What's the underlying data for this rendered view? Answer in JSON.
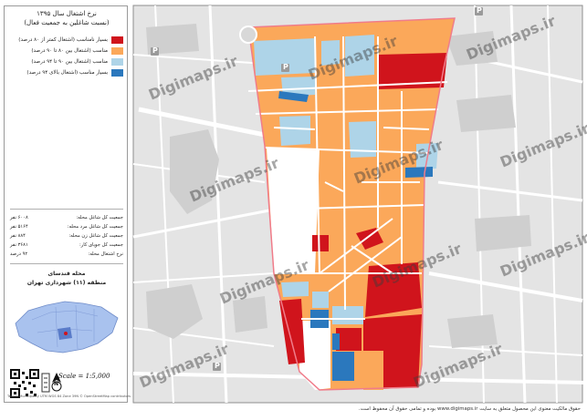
{
  "panel": {
    "title_line1": "نرخ اشتغال سال ۱۳۹۵",
    "title_line2": "(نسبت شاغلین به جمعیت فعال)",
    "legend": [
      {
        "label": "بسیار نامناسب (اشتغال کمتر از ۸۰ درصد)",
        "color": "#d0141c"
      },
      {
        "label": "مناسب (اشتغال بین ۸۰ تا ۹۰ درصد)",
        "color": "#fba85a"
      },
      {
        "label": "مناسب (اشتغال بین ۹۰ تا ۹۴ درصد)",
        "color": "#aed4e8"
      },
      {
        "label": "بسیار مناسب (اشتغال بالای ۹۴ درصد)",
        "color": "#2b78bd"
      }
    ],
    "stats": [
      {
        "label": "جمعیت کل شاغل محله:",
        "value": "۶۰۰۸ نفر"
      },
      {
        "label": "جمعیت کل شاغل مرد محله:",
        "value": "۵۱۶۴ نفر"
      },
      {
        "label": "جمعیت کل شاغل زن محله:",
        "value": "۸۸۴ نفر"
      },
      {
        "label": "جمعیت کل جویای کار:",
        "value": "۳۶۸۱ نفر"
      },
      {
        "label": "نرخ اشتغال محله:",
        "value": "۹۲ درصد"
      }
    ],
    "area_name": "محله قندسای",
    "district": "منطقه (۱۱) شهرداری تهران",
    "scale": "Scale = 1:5,000",
    "north_label": "N",
    "credit": "Tehran Municipality UTM WGS 84 Zone 39N  © OpenStreetMap contributors"
  },
  "map": {
    "watermark": "Digimaps.ir",
    "parking_label": "P",
    "block_colors": {
      "very_low": "#d0141c",
      "medium": "#fba85a",
      "good": "#aed4e8",
      "very_good": "#2b78bd",
      "no_data": "#ffffff"
    },
    "boundary_color": "#f07c8a"
  },
  "footer": {
    "text": "حقوق مالکیت معنوی این محصول متعلق به سایت www.digimaps.ir بوده و تمامی حقوق آن محفوظ است."
  }
}
